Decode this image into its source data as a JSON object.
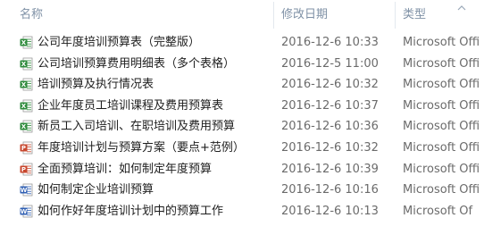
{
  "columns": {
    "name": "名称",
    "modified": "修改日期",
    "type": "类型"
  },
  "files": [
    {
      "name": "公司年度培训预算表（完整版）",
      "modified": "2016-12-6 10:33",
      "type": "Microsoft Offi",
      "icon": "excel-file-icon"
    },
    {
      "name": "公司培训预算费用明细表（多个表格）",
      "modified": "2016-12-5 11:00",
      "type": "Microsoft Offi",
      "icon": "excel-file-icon"
    },
    {
      "name": "培训预算及执行情况表",
      "modified": "2016-12-6 10:32",
      "type": "Microsoft Offi",
      "icon": "excel-file-icon"
    },
    {
      "name": "企业年度员工培训课程及费用预算表",
      "modified": "2016-12-6 10:37",
      "type": "Microsoft Offi",
      "icon": "excel-file-icon"
    },
    {
      "name": "新员工入司培训、在职培训及费用预算",
      "modified": "2016-12-6 10:36",
      "type": "Microsoft Offi",
      "icon": "excel-file-icon"
    },
    {
      "name": "年度培训计划与预算方案（要点+范例）",
      "modified": "2016-12-6 10:32",
      "type": "Microsoft Offi",
      "icon": "powerpoint-file-icon"
    },
    {
      "name": "全面预算培训：如何制定年度预算",
      "modified": "2016-12-6 10:39",
      "type": "Microsoft Offi",
      "icon": "powerpoint-file-icon"
    },
    {
      "name": "如何制定企业培训预算",
      "modified": "2016-12-6 10:16",
      "type": "Microsoft Offi",
      "icon": "word-file-icon"
    },
    {
      "name": "如何作好年度培训计划中的预算工作",
      "modified": "2016-12-6 10:13",
      "type": "Microsoft Of",
      "icon": "word-file-icon"
    }
  ],
  "colors": {
    "excel": "#2e8b3c",
    "powerpoint": "#c8472e",
    "word": "#2f5fb3",
    "header_text": "#7f91a6"
  }
}
